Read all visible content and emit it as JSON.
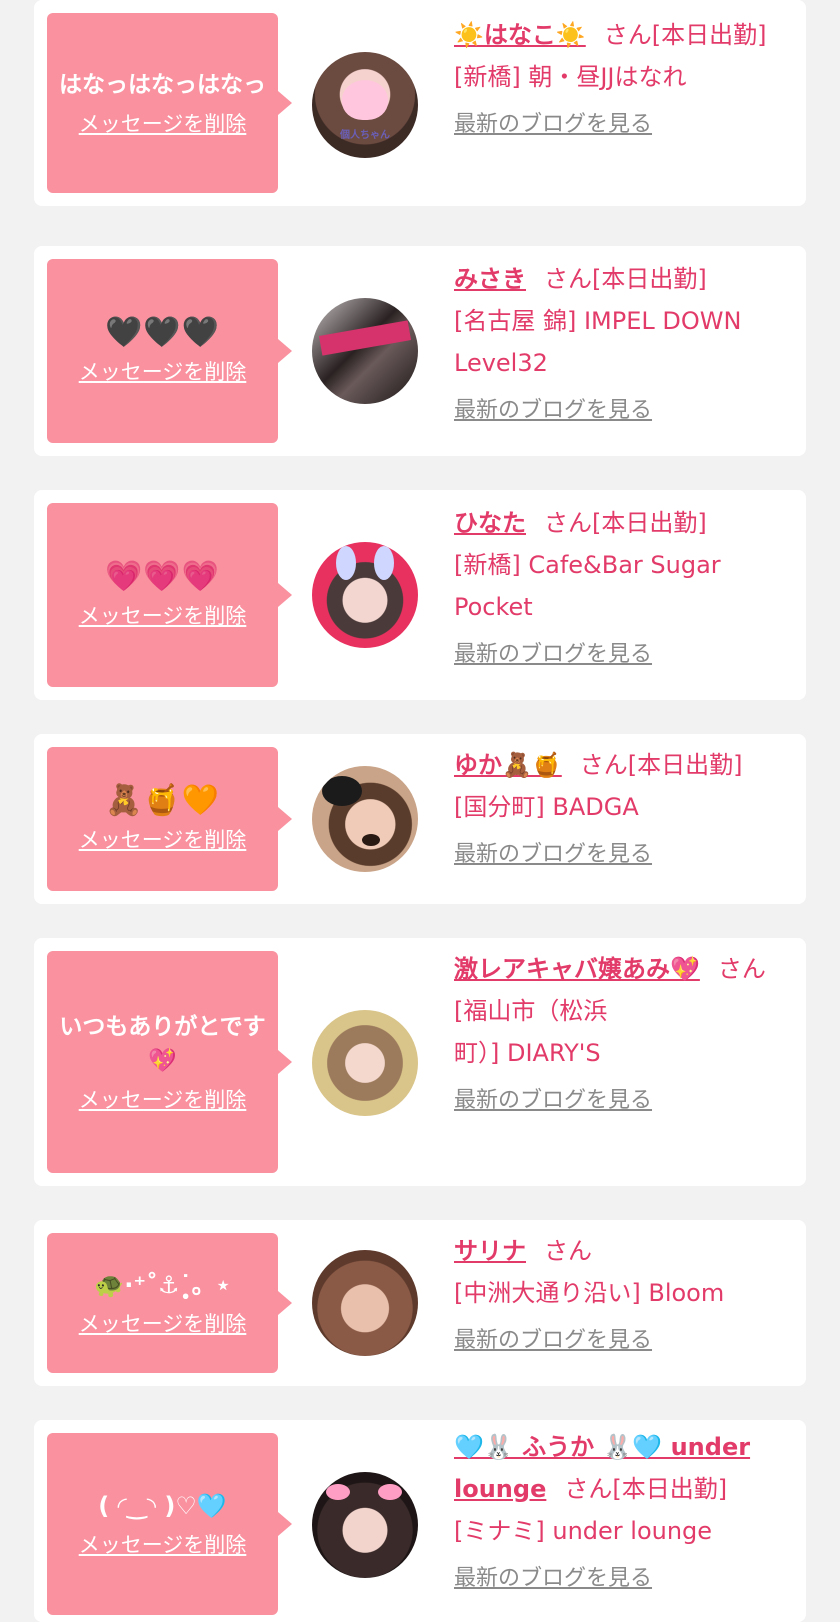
{
  "delete_label": "メッセージを削除",
  "blog_label": "最新のブログを見る",
  "san_label": "さん",
  "entries": [
    {
      "message": "はなっはなっはなっ",
      "name": "☀️はなこ☀️",
      "status": "[本日出勤]",
      "shop": "[新橋] 朝・昼JJはなれ",
      "avatar_caption": "個人ちゃん"
    },
    {
      "message": "🖤🖤🖤",
      "name": "みさき",
      "status": "[本日出勤]",
      "shop": "[名古屋 錦] IMPEL DOWN Level32"
    },
    {
      "message": "💗💗💗",
      "name": "ひなた",
      "status": "[本日出勤]",
      "shop": "[新橋] Cafe&Bar Sugar Pocket"
    },
    {
      "message": "🧸🍯🧡",
      "name": "ゆか🧸🍯",
      "status": "[本日出勤]",
      "shop": "[国分町] BADGA"
    },
    {
      "message": "いつもありがとです💖",
      "name": "激レアキャバ嬢あみ💖",
      "status": "",
      "shop": "[福山市（松浜町）] DIARY'S"
    },
    {
      "message": "🐢·⁺˚⚓︎˙̩̥。⋆",
      "name": "サリナ",
      "status": "",
      "shop": "[中洲大通り沿い] Bloom"
    },
    {
      "message": "( ◜‿◝ )♡🩵",
      "name": "🩵🐰 ふうか 🐰🩵 under lounge",
      "status": "[本日出勤]",
      "shop": "[ミナミ] under lounge"
    }
  ]
}
